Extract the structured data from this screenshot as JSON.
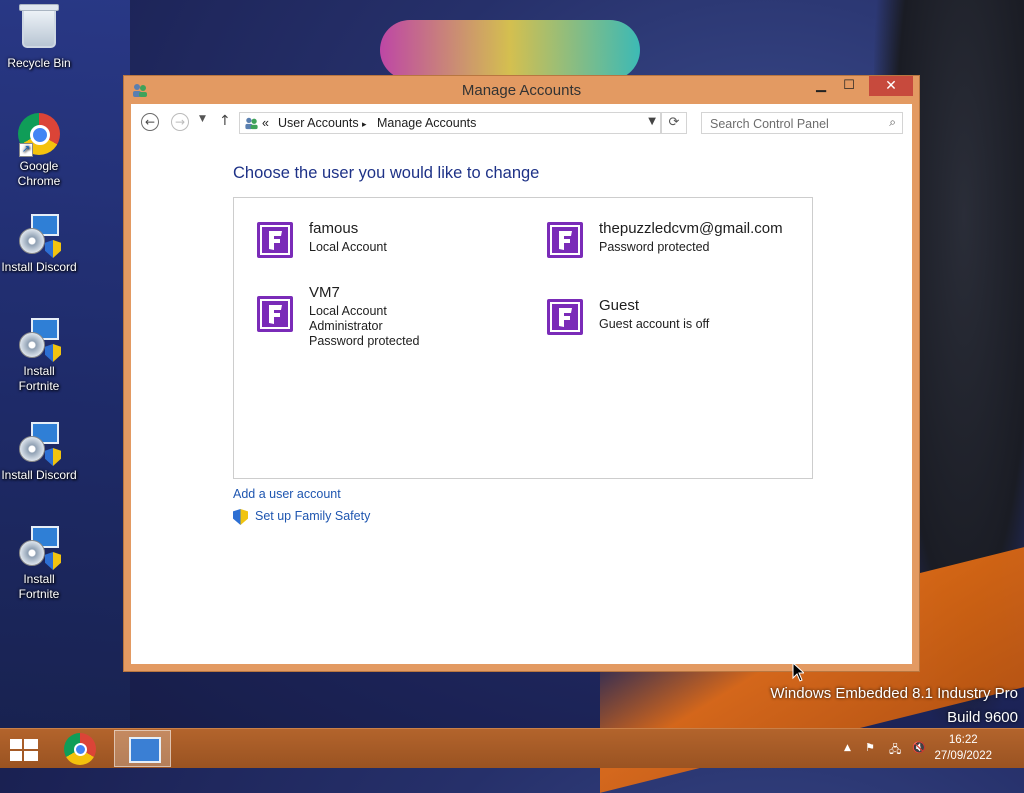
{
  "desktop": {
    "icons": [
      {
        "label": "Recycle Bin",
        "icon": "recycle-bin-icon"
      },
      {
        "label": "Google Chrome",
        "icon": "chrome-icon"
      },
      {
        "label": "Install Discord",
        "icon": "installer-icon"
      },
      {
        "label": "Install Fortnite",
        "icon": "installer-icon"
      },
      {
        "label": "Install Discord",
        "icon": "installer-icon"
      },
      {
        "label": "Install Fortnite",
        "icon": "installer-icon"
      }
    ],
    "watermark": {
      "line1": "Windows Embedded 8.1 Industry Pro",
      "line2": "Build 9600"
    }
  },
  "window": {
    "title": "Manage Accounts",
    "controls": {
      "minimize": "▁",
      "maximize": "☐",
      "close": "✕"
    },
    "address": {
      "prefix": "«",
      "crumbs": [
        "User Accounts",
        "Manage Accounts"
      ],
      "separator": "▸"
    },
    "search": {
      "placeholder": "Search Control Panel"
    },
    "heading": "Choose the user you would like to change",
    "accounts": [
      {
        "name": "famous",
        "lines": [
          "Local Account"
        ]
      },
      {
        "name": "thepuzzledcvm@gmail.com",
        "lines": [
          "Password protected"
        ]
      },
      {
        "name": "VM7",
        "lines": [
          "Local Account",
          "Administrator",
          "Password protected"
        ]
      },
      {
        "name": "Guest",
        "lines": [
          "Guest account is off"
        ]
      }
    ],
    "links": {
      "add_user": "Add a user account",
      "family_safety": "Set up Family Safety"
    },
    "colors": {
      "heading": "#1e3287",
      "link": "#1f56b0",
      "frame": "#e39a62",
      "avatar": "#7a2bb8"
    }
  },
  "taskbar": {
    "clock": {
      "time": "16:22",
      "date": "27/09/2022"
    }
  }
}
